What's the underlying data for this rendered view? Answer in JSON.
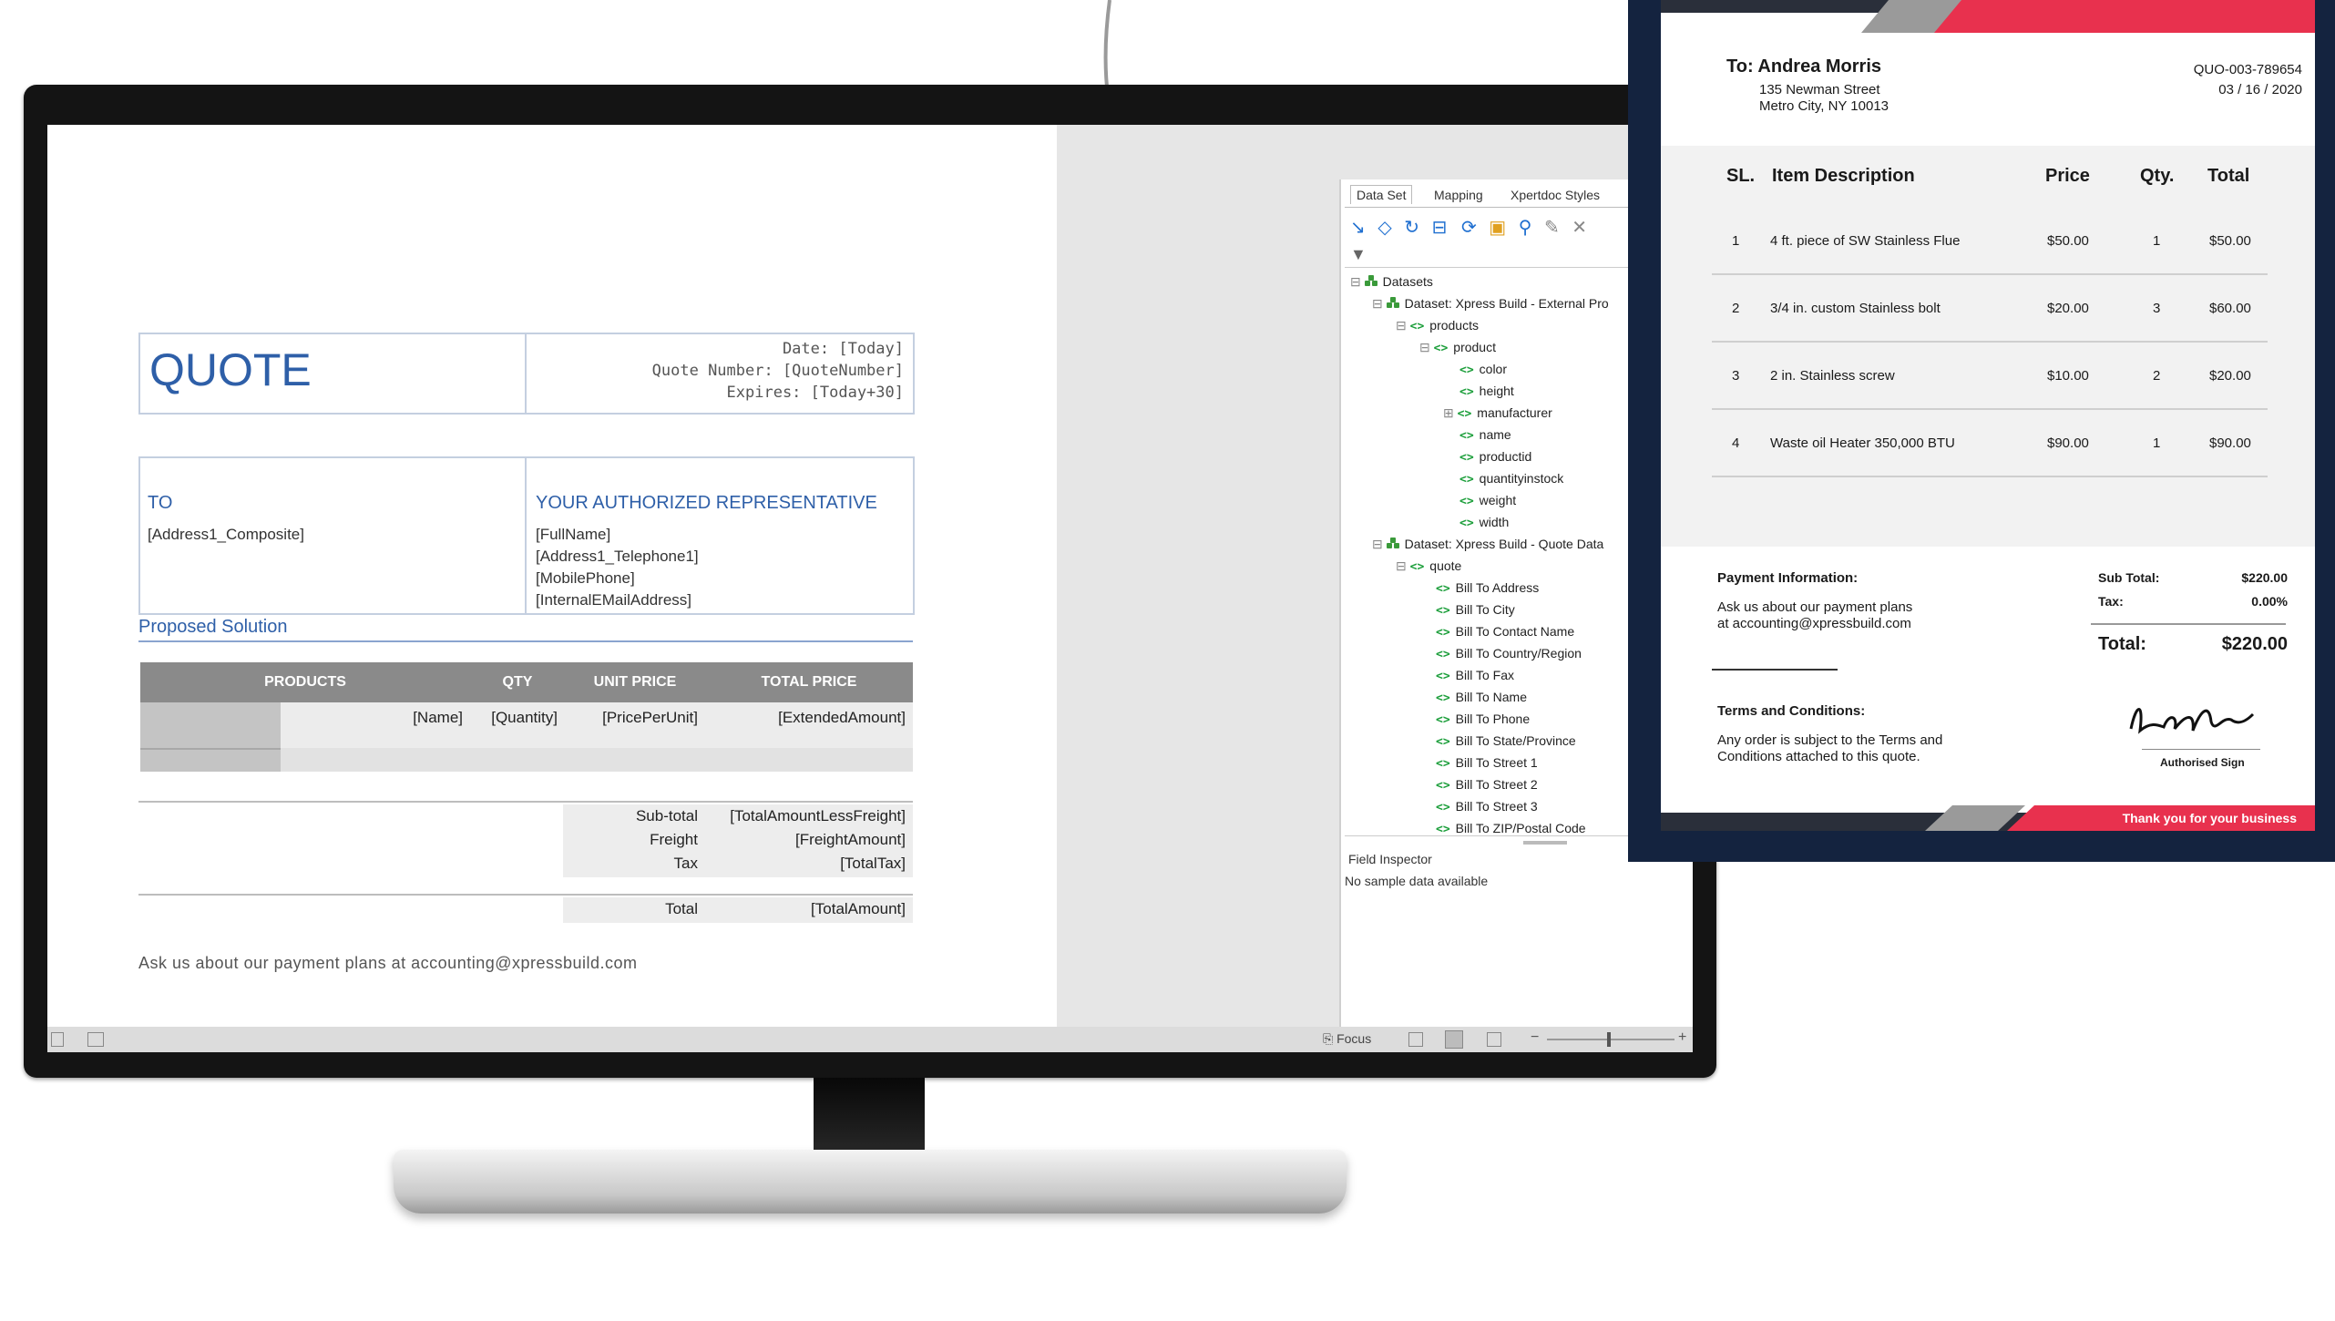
{
  "quote": {
    "title": "QUOTE",
    "meta_date": "Date: [Today]",
    "meta_number": "Quote Number: [QuoteNumber]",
    "meta_expires": "Expires: [Today+30]",
    "to_label": "TO",
    "to_value": "[Address1_Composite]",
    "rep_label": "YOUR AUTHORIZED REPRESENTATIVE",
    "rep_lines": [
      "[FullName]",
      "[Address1_Telephone1]",
      "[MobilePhone]",
      "[InternalEMailAddress]"
    ],
    "section_title": "Proposed Solution",
    "columns": [
      "PRODUCTS",
      "QTY",
      "UNIT PRICE",
      "TOTAL PRICE"
    ],
    "row": [
      "[Name]",
      "[Quantity]",
      "[PricePerUnit]",
      "[ExtendedAmount]"
    ],
    "totals": [
      {
        "label": "Sub-total",
        "value": "[TotalAmountLessFreight]"
      },
      {
        "label": "Freight",
        "value": "[FreightAmount]"
      },
      {
        "label": "Tax",
        "value": "[TotalTax]"
      }
    ],
    "total_label": "Total",
    "total_value": "[TotalAmount]",
    "footer": "Ask us about our payment plans at accounting@xpressbuild.com"
  },
  "panel": {
    "tabs": [
      "Data Set",
      "Mapping",
      "Xpertdoc Styles"
    ],
    "tree": {
      "root": "Datasets",
      "dataset1": "Dataset: Xpress Build - External Pro",
      "products": "products",
      "product": "product",
      "fields": [
        "color",
        "height",
        "manufacturer",
        "name",
        "productid",
        "quantityinstock",
        "weight",
        "width"
      ],
      "dataset2": "Dataset: Xpress Build - Quote Data",
      "quote": "quote",
      "quote_fields": [
        "Bill To Address",
        "Bill To City",
        "Bill To Contact Name",
        "Bill To Country/Region",
        "Bill To Fax",
        "Bill To Name",
        "Bill To Phone",
        "Bill To State/Province",
        "Bill To Street 1",
        "Bill To Street 2",
        "Bill To Street 3",
        "Bill To ZIP/Postal Code"
      ]
    },
    "inspector_title": "Field Inspector",
    "inspector_text": "No sample data available"
  },
  "statusbar": {
    "focus": "Focus"
  },
  "invoice": {
    "to": "To: Andrea Morris",
    "address1": "135 Newman Street",
    "address2": "Metro City, NY 10013",
    "number": "QUO-003-789654",
    "date": "03 / 16 / 2020",
    "headers": [
      "SL.",
      "Item Description",
      "Price",
      "Qty.",
      "Total"
    ],
    "items": [
      {
        "sl": "1",
        "desc": "4 ft. piece of SW Stainless Flue",
        "price": "$50.00",
        "qty": "1",
        "total": "$50.00"
      },
      {
        "sl": "2",
        "desc": "3/4 in. custom Stainless bolt",
        "price": "$20.00",
        "qty": "3",
        "total": "$60.00"
      },
      {
        "sl": "3",
        "desc": "2 in. Stainless screw",
        "price": "$10.00",
        "qty": "2",
        "total": "$20.00"
      },
      {
        "sl": "4",
        "desc": "Waste oil Heater 350,000 BTU",
        "price": "$90.00",
        "qty": "1",
        "total": "$90.00"
      }
    ],
    "payment_title": "Payment Information:",
    "payment_text1": "Ask us about our payment plans",
    "payment_text2": "at accounting@xpressbuild.com",
    "subtotal_label": "Sub Total:",
    "subtotal_value": "$220.00",
    "tax_label": "Tax:",
    "tax_value": "0.00%",
    "total_label": "Total:",
    "total_value": "$220.00",
    "terms_title": "Terms and Conditions:",
    "terms_text1": "Any order is subject to the Terms and",
    "terms_text2": "Conditions attached to this quote.",
    "sign_label": "Authorised Sign",
    "thanks": "Thank you for your business",
    "accent_color": "#e8314e",
    "frame_color": "#14233f"
  }
}
